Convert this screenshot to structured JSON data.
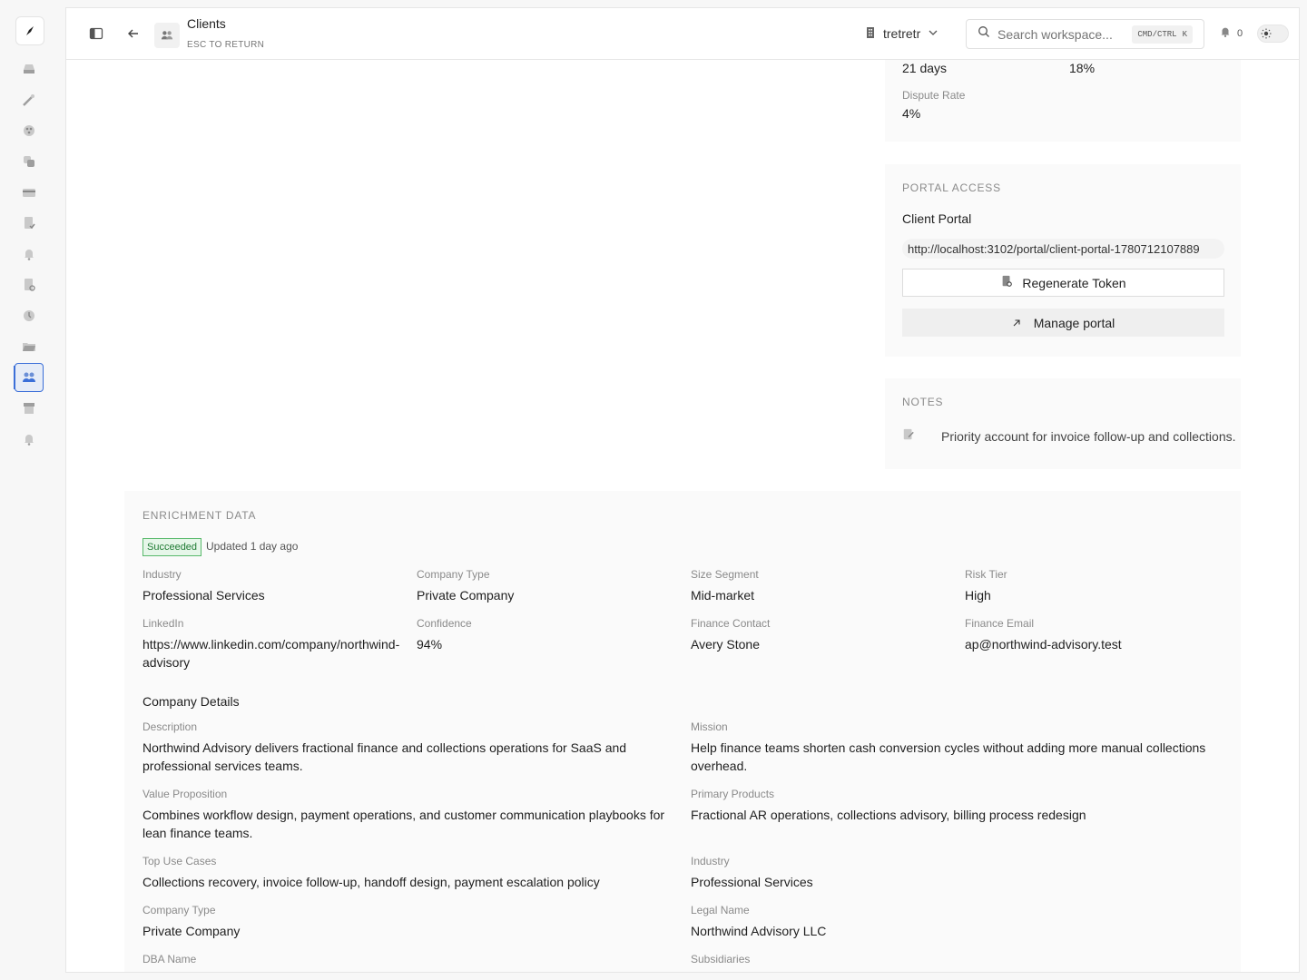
{
  "header": {
    "title": "Clients",
    "subtitle": "ESC TO RETURN",
    "workspace": "tretretr",
    "search_placeholder": "Search workspace...",
    "shortcut_mod": "CMD/CTRL",
    "shortcut_key": "K",
    "notification_count": "0"
  },
  "metrics": {
    "top_left_value": "21 days",
    "top_right_value": "18%",
    "dispute_label": "Dispute Rate",
    "dispute_value": "4%"
  },
  "portal": {
    "section_title": "PORTAL ACCESS",
    "name": "Client Portal",
    "url": "http://localhost:3102/portal/client-portal-1780712107889",
    "regenerate_label": "Regenerate Token",
    "manage_label": "Manage portal"
  },
  "notes": {
    "section_title": "NOTES",
    "text": "Priority account for invoice follow-up and collections."
  },
  "enrichment": {
    "section_title": "ENRICHMENT DATA",
    "status": "Succeeded",
    "updated": "Updated 1 day ago",
    "fields": [
      {
        "label": "Industry",
        "value": "Professional Services"
      },
      {
        "label": "Company Type",
        "value": "Private Company"
      },
      {
        "label": "Size Segment",
        "value": "Mid-market"
      },
      {
        "label": "Risk Tier",
        "value": "High"
      },
      {
        "label": "LinkedIn",
        "value": "https://www.linkedin.com/company/northwind-advisory"
      },
      {
        "label": "Confidence",
        "value": "94%"
      },
      {
        "label": "Finance Contact",
        "value": "Avery Stone"
      },
      {
        "label": "Finance Email",
        "value": "ap@northwind-advisory.test"
      }
    ],
    "company_details_title": "Company Details",
    "details": [
      {
        "label": "Description",
        "value": "Northwind Advisory delivers fractional finance and collections operations for SaaS and professional services teams."
      },
      {
        "label": "Mission",
        "value": "Help finance teams shorten cash conversion cycles without adding more manual collections overhead."
      },
      {
        "label": "Value Proposition",
        "value": "Combines workflow design, payment operations, and customer communication playbooks for lean finance teams."
      },
      {
        "label": "Primary Products",
        "value": "Fractional AR operations, collections advisory, billing process redesign"
      },
      {
        "label": "Top Use Cases",
        "value": "Collections recovery, invoice follow-up, handoff design, payment escalation policy"
      },
      {
        "label": "Industry",
        "value": "Professional Services"
      },
      {
        "label": "Company Type",
        "value": "Private Company"
      },
      {
        "label": "Legal Name",
        "value": "Northwind Advisory LLC"
      },
      {
        "label": "DBA Name",
        "value": ""
      },
      {
        "label": "Subsidiaries",
        "value": ""
      }
    ]
  },
  "sidebar": {
    "icons": [
      "inbox-icon",
      "wand-icon",
      "palette-icon",
      "copy-icon",
      "card-icon",
      "document-check-icon",
      "bell-icon",
      "document-refresh-icon",
      "clock-icon",
      "folder-icon",
      "users-icon",
      "archive-icon",
      "bell-icon"
    ],
    "active_index": 10
  }
}
